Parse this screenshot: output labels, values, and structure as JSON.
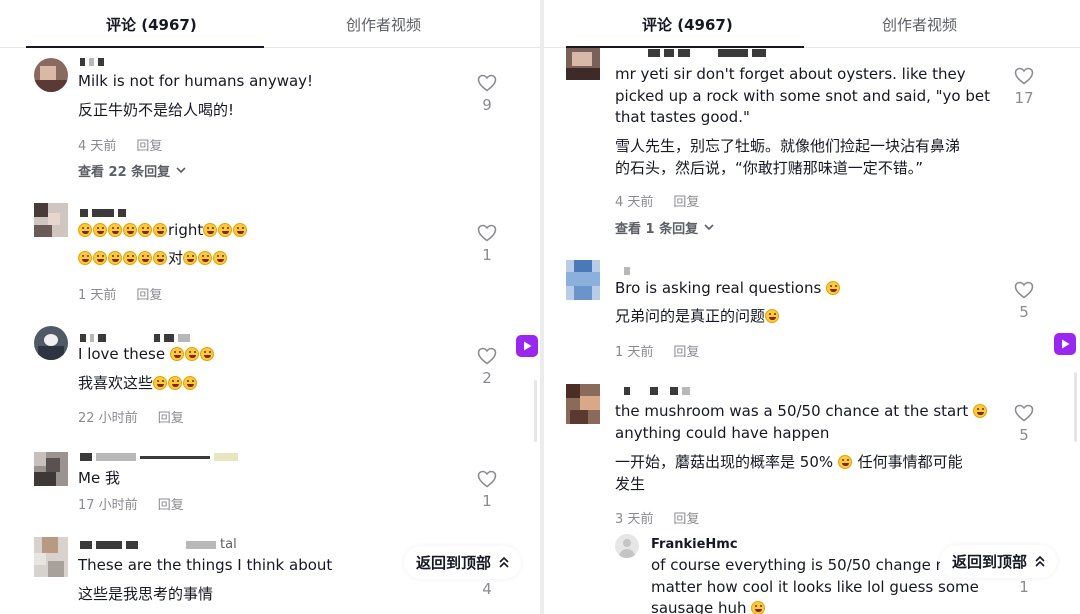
{
  "left": {
    "tabs": {
      "comments": "评论 (4967)",
      "creator_videos": "创作者视频"
    },
    "comments": [
      {
        "text_en": "Milk is not for humans anyway!",
        "text_zh": "反正牛奶不是给人喝的!",
        "time": "4 天前",
        "reply": "回复",
        "view_replies": "查看 22 条回复",
        "likes": "9"
      },
      {
        "text_en": "right",
        "text_zh": "对",
        "time": "1 天前",
        "reply": "回复",
        "likes": "1"
      },
      {
        "text_en": "I love these",
        "text_zh": "我喜欢这些",
        "time": "22 小时前",
        "reply": "回复",
        "likes": "2"
      },
      {
        "text_en": "Me  我",
        "time": "17 小时前",
        "reply": "回复",
        "likes": "1"
      },
      {
        "name_suffix": "tal",
        "text_en": "These are the things I think about",
        "text_zh": "这些是我思考的事情",
        "likes": "4"
      }
    ],
    "back_to_top": "返回到顶部"
  },
  "right": {
    "tabs": {
      "comments": "评论 (4967)",
      "creator_videos": "创作者视频"
    },
    "comments": [
      {
        "text_en_1": "mr yeti sir don't forget about oysters. like they",
        "text_en_2": "picked up a rock with some snot and said, \"yo bet",
        "text_en_3": "that tastes good.\"",
        "text_zh_1": "雪人先生，别忘了牡蛎。就像他们捡起一块沾有鼻涕",
        "text_zh_2": "的石头，然后说，“你敢打赌那味道一定不错。”",
        "time": "4 天前",
        "reply": "回复",
        "view_replies": "查看 1 条回复",
        "likes": "17"
      },
      {
        "text_en": "Bro is asking real questions",
        "text_zh": "兄弟问的是真正的问题",
        "time": "1 天前",
        "reply": "回复",
        "likes": "5"
      },
      {
        "text_en_1": "the mushroom was a 50/50 chance at the start",
        "text_en_2": "anything could have happen",
        "text_zh_1": "一开始，蘑菇出现的概率是 50%",
        "text_zh_1b": "任何事情都可能",
        "text_zh_2": "发生",
        "time": "3 天前",
        "reply": "回复",
        "likes": "5"
      }
    ],
    "reply": {
      "name": "FrankieHmc",
      "text_1": "of course everything is 50/50 change n",
      "text_2": "matter how cool it looks like lol guess some",
      "text_3": "sausage huh",
      "likes": "1"
    },
    "back_to_top": "返回到顶部"
  },
  "colors": {
    "accent_purple": "#9a27f0",
    "text_primary": "#161823",
    "text_secondary": "#8a8b91"
  }
}
